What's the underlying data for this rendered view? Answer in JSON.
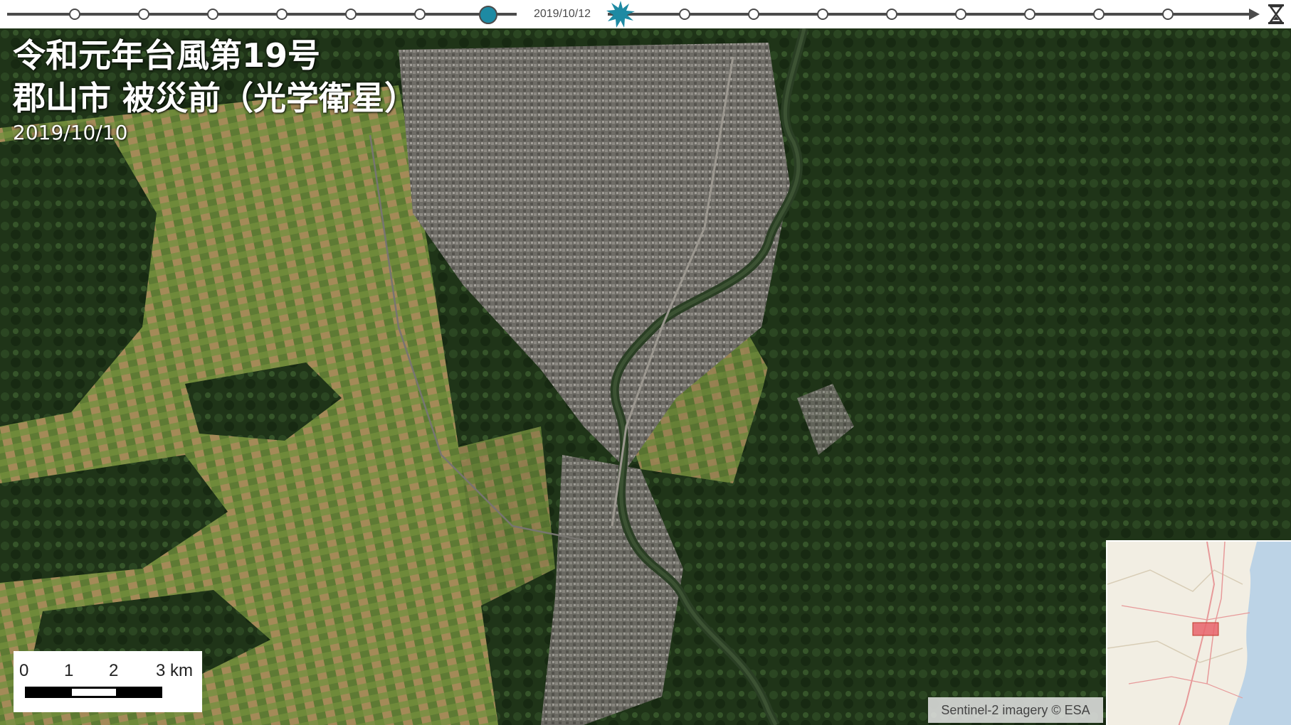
{
  "timeline": {
    "selected_date": "2019/10/12",
    "colors": {
      "line": "#4b4b4b",
      "active": "#1e8aa3",
      "event": "#1e8aa3"
    },
    "icons": {
      "event": "burst-icon",
      "end": "hourglass-icon",
      "arrow": "arrow-right-icon"
    }
  },
  "map": {
    "title_line1": "令和元年台風第19号",
    "title_line2": "郡山市 被災前（光学衛星）",
    "date": "2019/10/10",
    "attribution": "Sentinel-2 imagery © ESA",
    "scalebar": {
      "labels": [
        "0",
        "1",
        "2",
        "3 km"
      ]
    },
    "inset_colors": {
      "land": "#f2eee3",
      "sea": "#bcd3e6",
      "highlight": "#e8636b",
      "road": "#e79a9a"
    }
  }
}
